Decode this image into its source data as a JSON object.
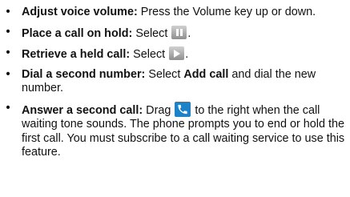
{
  "bullet_char": "•",
  "items": [
    {
      "term": "Adjust voice volume:",
      "text": " Press the Volume key up or down."
    },
    {
      "term": "Place a call on hold:",
      "text_before": " Select ",
      "icon": "pause-icon",
      "text_after": "."
    },
    {
      "term": "Retrieve a held call:",
      "text_before": " Select ",
      "icon": "play-icon",
      "text_after": "."
    },
    {
      "term": "Dial a second number:",
      "text_before": " Select ",
      "bold_text": "Add call",
      "text_after": " and dial the new number."
    },
    {
      "term": "Answer a second call:",
      "text_before": " Drag ",
      "icon": "phone-answer-icon",
      "text_after": " to the right when the call waiting tone sounds. The phone prompts you to end or hold the first call. You must subscribe to a call waiting service to use this feature."
    }
  ],
  "colors": {
    "text": "#111111",
    "icon_gray": "#a8a8a8",
    "icon_blue": "#1e82c8"
  }
}
